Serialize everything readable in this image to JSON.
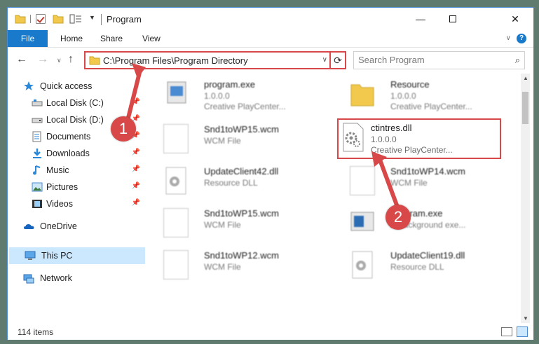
{
  "window": {
    "title": "Program",
    "controls": {
      "minimize": "—",
      "maximize": "",
      "close": "✕"
    }
  },
  "ribbon": {
    "tabs": [
      "File",
      "Home",
      "Share",
      "View"
    ],
    "help": "?"
  },
  "address": {
    "path": "C:\\Program Files\\Program Directory",
    "refresh_icon": "⟳"
  },
  "search": {
    "placeholder": "Search Program"
  },
  "navpane": {
    "items": [
      {
        "label": "Quick access",
        "icon": "star-icon"
      },
      {
        "label": "Local Disk (C:)",
        "icon": "drive-icon",
        "pinned": true
      },
      {
        "label": "Local Disk (D:)",
        "icon": "drive-icon",
        "pinned": true
      },
      {
        "label": "Documents",
        "icon": "documents-icon",
        "pinned": true
      },
      {
        "label": "Downloads",
        "icon": "downloads-icon",
        "pinned": true
      },
      {
        "label": "Music",
        "icon": "music-icon",
        "pinned": true
      },
      {
        "label": "Pictures",
        "icon": "pictures-icon",
        "pinned": true
      },
      {
        "label": "Videos",
        "icon": "videos-icon",
        "pinned": true
      },
      {
        "label": "OneDrive",
        "icon": "onedrive-icon"
      },
      {
        "label": "This PC",
        "icon": "computer-icon",
        "selected": true
      },
      {
        "label": "Network",
        "icon": "network-icon"
      }
    ]
  },
  "files": [
    {
      "name": "program.exe",
      "line1": "1.0.0.0",
      "line2": "Creative PlayCenter..."
    },
    {
      "name": "Resource",
      "line1": "1.0.0.0",
      "line2": "Creative PlayCenter..."
    },
    {
      "name": "Snd1toWP15.wcm",
      "line1": "WCM File",
      "line2": ""
    },
    {
      "name": "UpdateClient42.dll",
      "line1": "Resource DLL",
      "line2": ""
    },
    {
      "name": "Snd1toWP14.wcm",
      "line1": "WCM File",
      "line2": ""
    },
    {
      "name": "Snd1toWP15.wcm",
      "line1": "WCM File",
      "line2": ""
    },
    {
      "name": "Program.exe",
      "line1": "A Background exe...",
      "line2": ""
    },
    {
      "name": "Snd1toWP12.wcm",
      "line1": "WCM File",
      "line2": ""
    },
    {
      "name": "UpdateClient19.dll",
      "line1": "Resource DLL",
      "line2": ""
    }
  ],
  "highlighted_file": {
    "name": "ctintres.dll",
    "line1": "1.0.0.0",
    "line2": "Creative PlayCenter..."
  },
  "status": {
    "item_count": "114 items"
  },
  "annotations": {
    "step1": "1",
    "step2": "2",
    "color": "#d94848"
  },
  "colors": {
    "accent": "#1979ca",
    "highlight": "#d94848",
    "selection": "#cce8ff"
  }
}
